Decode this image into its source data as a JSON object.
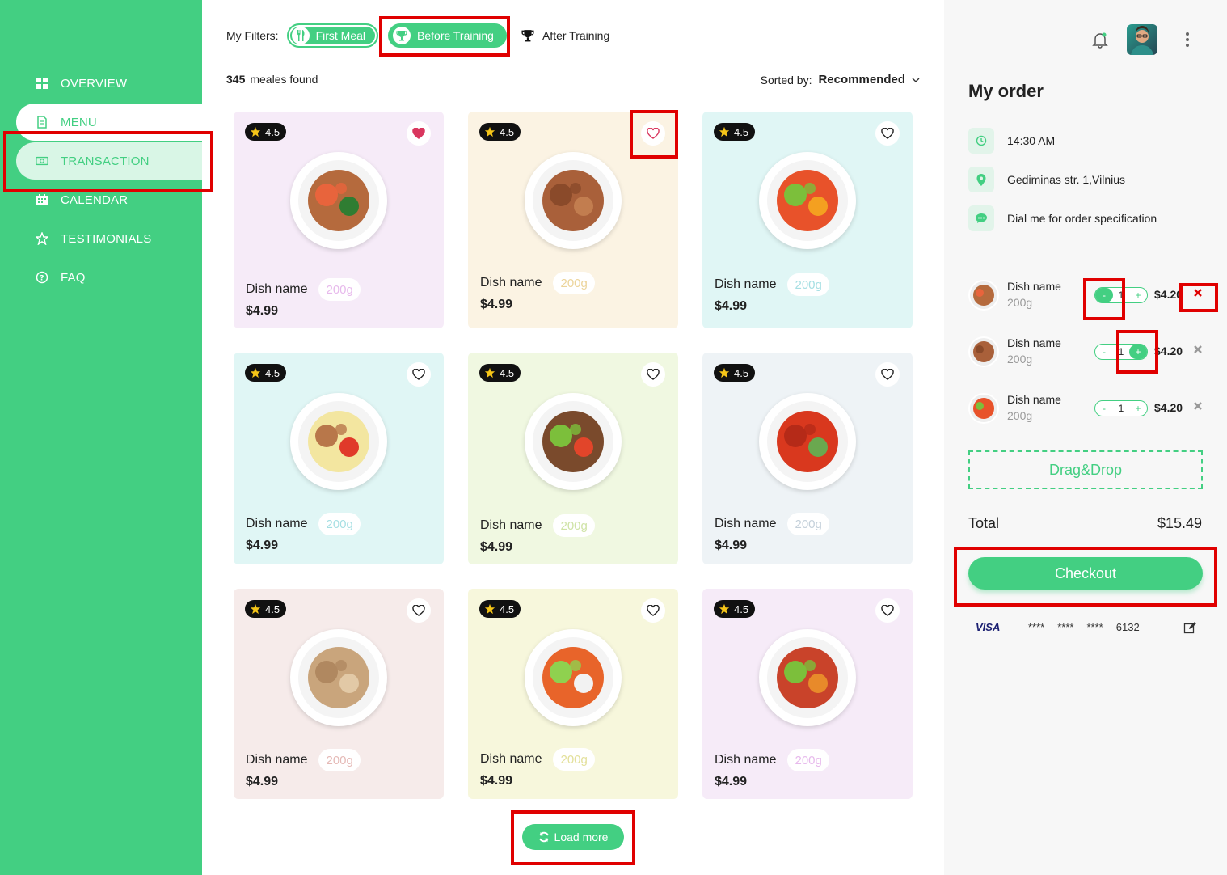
{
  "sidebar": {
    "items": [
      {
        "label": "OVERVIEW",
        "icon": "grid-icon"
      },
      {
        "label": "MENU",
        "icon": "document-icon"
      },
      {
        "label": "TRANSACTION",
        "icon": "money-icon"
      },
      {
        "label": "CALENDAR",
        "icon": "calendar-icon"
      },
      {
        "label": "TESTIMONIALS",
        "icon": "star-icon"
      },
      {
        "label": "FAQ",
        "icon": "question-icon"
      }
    ]
  },
  "filters": {
    "label": "My Filters:",
    "chips": [
      {
        "label": "First Meal",
        "icon": "fork-knife-icon",
        "active": false
      },
      {
        "label": "Before Training",
        "icon": "trophy-icon",
        "active": true
      },
      {
        "label": "After Training",
        "icon": "trophy-icon",
        "active": false
      }
    ]
  },
  "results": {
    "count": "345",
    "suffix": "meales found"
  },
  "sort": {
    "label": "Sorted by:",
    "value": "Recommended"
  },
  "cards": [
    {
      "rating": "4.5",
      "name": "Dish name",
      "weight": "200g",
      "price": "$4.99",
      "bg": "#f6ebf8",
      "weight_color": "#e7b9ec",
      "favorite": true
    },
    {
      "rating": "4.5",
      "name": "Dish name",
      "weight": "200g",
      "price": "$4.99",
      "bg": "#fbf3e3",
      "weight_color": "#ecd49a",
      "favorite": false
    },
    {
      "rating": "4.5",
      "name": "Dish name",
      "weight": "200g",
      "price": "$4.99",
      "bg": "#e0f6f5",
      "weight_color": "#a6dfe3",
      "favorite": false
    },
    {
      "rating": "4.5",
      "name": "Dish name",
      "weight": "200g",
      "price": "$4.99",
      "bg": "#e0f6f5",
      "weight_color": "#a6dfe3",
      "favorite": false
    },
    {
      "rating": "4.5",
      "name": "Dish name",
      "weight": "200g",
      "price": "$4.99",
      "bg": "#f0f8e1",
      "weight_color": "#cfe3a6",
      "favorite": false
    },
    {
      "rating": "4.5",
      "name": "Dish name",
      "weight": "200g",
      "price": "$4.99",
      "bg": "#eef3f6",
      "weight_color": "#c4d0da",
      "favorite": false
    },
    {
      "rating": "4.5",
      "name": "Dish name",
      "weight": "200g",
      "price": "$4.99",
      "bg": "#f6ebea",
      "weight_color": "#e5b9b6",
      "favorite": false
    },
    {
      "rating": "4.5",
      "name": "Dish name",
      "weight": "200g",
      "price": "$4.99",
      "bg": "#f7f7dc",
      "weight_color": "#e3e09a",
      "favorite": false
    },
    {
      "rating": "4.5",
      "name": "Dish name",
      "weight": "200g",
      "price": "$4.99",
      "bg": "#f6ebf8",
      "weight_color": "#e7b9ec",
      "favorite": false
    }
  ],
  "load_more": "Load more",
  "order": {
    "title": "My order",
    "time": "14:30 AM",
    "address": "Gediminas str. 1,Vilnius",
    "note": "Dial me for order specification",
    "items": [
      {
        "name": "Dish name",
        "weight": "200g",
        "qty": "1",
        "price": "$4.20",
        "minus": "-",
        "plus": "+"
      },
      {
        "name": "Dish name",
        "weight": "200g",
        "qty": "1",
        "price": "$4.20",
        "minus": "-",
        "plus": "+"
      },
      {
        "name": "Dish name",
        "weight": "200g",
        "qty": "1",
        "price": "$4.20",
        "minus": "-",
        "plus": "+"
      }
    ],
    "dragdrop": "Drag&Drop",
    "total_label": "Total",
    "total_value": "$15.49",
    "checkout": "Checkout",
    "card_brand": "VISA",
    "card_mask": [
      "****",
      "****",
      "****",
      "6132"
    ]
  },
  "colors": {
    "accent": "#43cf82",
    "highlight": "#e00000",
    "heart_active": "#d9365e"
  }
}
